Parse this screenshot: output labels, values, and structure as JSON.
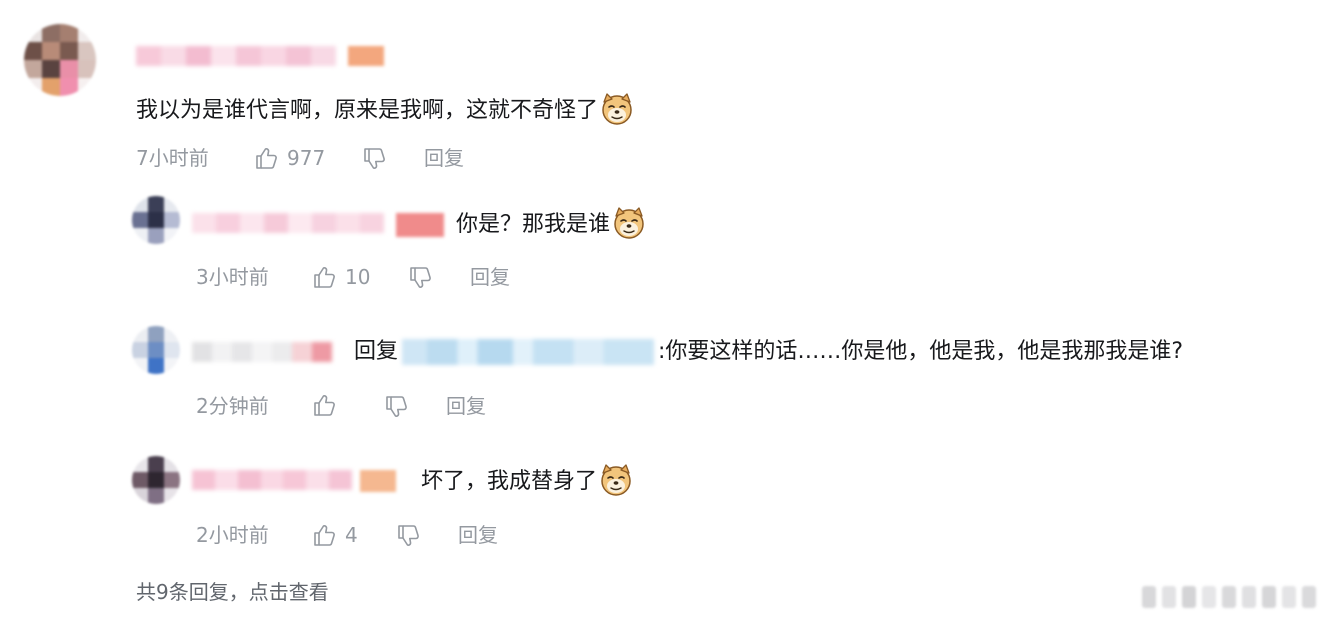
{
  "main_comment": {
    "text": "我以为是谁代言啊，原来是我啊，这就不奇怪了",
    "time": "7小时前",
    "likes": "977",
    "reply_label": "回复"
  },
  "replies": [
    {
      "text": "你是？那我是谁",
      "time": "3小时前",
      "likes": "10",
      "reply_label": "回复"
    },
    {
      "prefix": "回复",
      "text": ":你要这样的话……你是他，他是我，他是我那我是谁?",
      "time": "2分钟前",
      "likes": "",
      "reply_label": "回复"
    },
    {
      "text": "坏了，我成替身了",
      "time": "2小时前",
      "likes": "4",
      "reply_label": "回复"
    }
  ],
  "footer": {
    "more_replies": "共9条回复，点击查看"
  },
  "icons": {
    "like": "thumbs-up-icon",
    "dislike": "thumbs-down-icon",
    "emoji": "doge-emoji-icon"
  },
  "colors": {
    "text": "#18191c",
    "meta": "#9499a0",
    "footer": "#61666d",
    "mention_blur": "#cfe6f5"
  }
}
